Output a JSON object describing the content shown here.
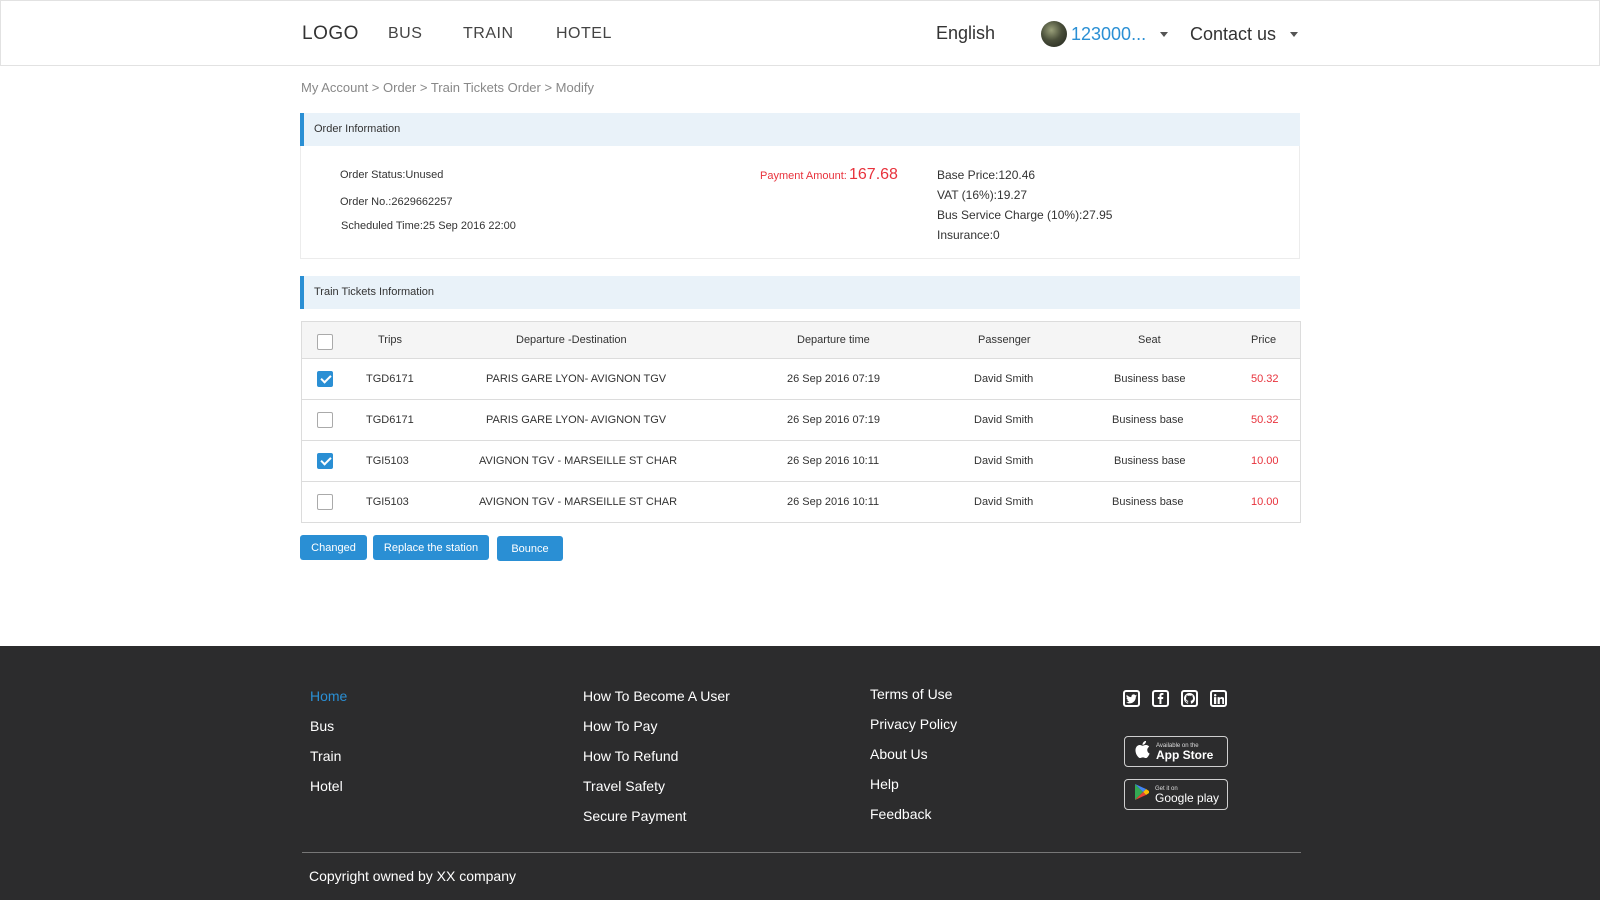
{
  "header": {
    "logo": "LOGO",
    "nav": [
      "BUS",
      "TRAIN",
      "HOTEL"
    ],
    "language": "English",
    "user_name": "123000...",
    "contact": "Contact us"
  },
  "breadcrumb": "My Account > Order > Train Tickets Order > Modify",
  "order_info": {
    "title": "Order Information",
    "status": "Order Status:Unused",
    "order_no": "Order No.:2629662257",
    "scheduled_time": "Scheduled Time:25  Sep  2016 22:00",
    "payment_label": "Payment  Amount:",
    "payment_amount": "167.68",
    "base_price": "Base Price:120.46",
    "vat": "VAT (16%):19.27",
    "service_charge": "Bus Service Charge (10%):27.95",
    "insurance": "Insurance:0"
  },
  "tickets": {
    "title": "Train Tickets Information",
    "columns": [
      "Trips",
      "Departure -Destination",
      "Departure time",
      "Passenger",
      "Seat",
      "Price"
    ],
    "rows": [
      {
        "checked": true,
        "trip": "TGD6171",
        "route": "PARIS GARE LYON- AVIGNON TGV",
        "time": "26  Sep  2016  07:19",
        "passenger": "David  Smith",
        "seat": "Business base",
        "price": "50.32"
      },
      {
        "checked": false,
        "trip": "TGD6171",
        "route": "PARIS GARE LYON- AVIGNON TGV",
        "time": "26  Sep  2016  07:19",
        "passenger": "David  Smith",
        "seat": "Business base",
        "price": "50.32"
      },
      {
        "checked": true,
        "trip": "TGI5103",
        "route": "AVIGNON TGV - MARSEILLE ST CHAR",
        "time": "26  Sep  2016  10:11",
        "passenger": "David  Smith",
        "seat": "Business base",
        "price": "10.00"
      },
      {
        "checked": false,
        "trip": "TGI5103",
        "route": "AVIGNON TGV - MARSEILLE ST CHAR",
        "time": "26  Sep  2016  10:11",
        "passenger": "David  Smith",
        "seat": "Business base",
        "price": "10.00"
      }
    ]
  },
  "actions": {
    "changed": "Changed",
    "replace_station": "Replace the station",
    "bounce": "Bounce"
  },
  "footer": {
    "col1": [
      "Home",
      "Bus",
      "Train",
      "Hotel"
    ],
    "col2": [
      "How To Become A User",
      "How To Pay",
      "How To Refund",
      "Travel Safety",
      "Secure Payment"
    ],
    "col3": [
      "Terms of Use",
      "Privacy Policy",
      "About Us",
      "Help",
      "Feedback"
    ],
    "social_icons": [
      "twitter-icon",
      "facebook-icon",
      "github-icon",
      "linkedin-icon"
    ],
    "app_store_small": "Available on the",
    "app_store_big": "App Store",
    "google_play_small": "Get it on",
    "google_play_big": "Google play",
    "copyright": "Copyright owned by XX company"
  },
  "colors": {
    "accent": "#2a8fd4",
    "price_red": "#e8323c",
    "footer_bg": "#2c2c2d",
    "section_bg": "#e9f2f9"
  }
}
